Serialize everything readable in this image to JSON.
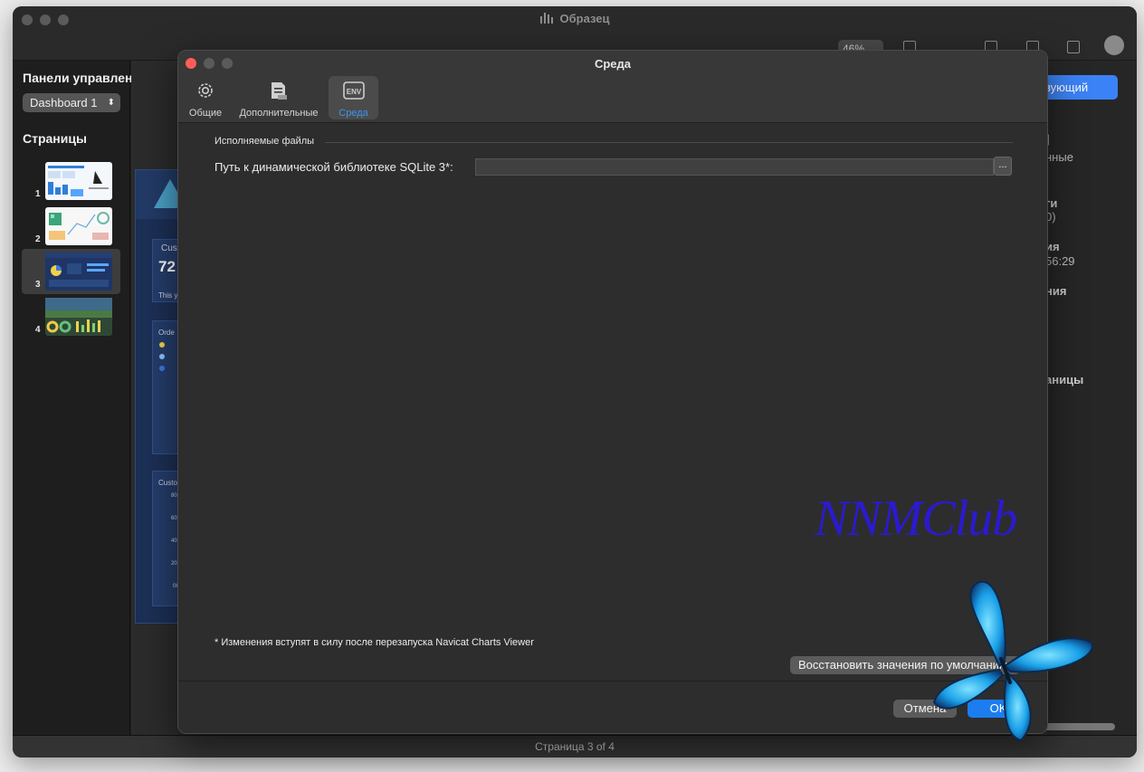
{
  "app": {
    "title": "Образец",
    "zoom": "46%",
    "status": "Страница 3 of 4"
  },
  "sidebar": {
    "title": "Панели управлени",
    "dashboard_select": "Dashboard 1",
    "pages_heading": "Страницы",
    "pages": [
      {
        "num": "1"
      },
      {
        "num": "2"
      },
      {
        "num": "3",
        "selected": true
      },
      {
        "num": "4"
      }
    ]
  },
  "background": {
    "card1_title": "Cus",
    "card1_value": "72",
    "card1_sub": "This y",
    "card2_title": "Orde",
    "card3_title": "Custo",
    "axis": [
      "80K",
      "60K",
      "40K",
      "20K",
      "0K"
    ],
    "right_button": "вующий",
    "right_texts": [
      "]",
      "нные",
      "ги",
      "0)",
      "ия",
      "56:29",
      "ния",
      "аницы"
    ]
  },
  "dialog": {
    "title": "Среда",
    "tabs": [
      {
        "label": "Общие",
        "icon": "gear-icon"
      },
      {
        "label": "Дополнительные",
        "icon": "document-icon"
      },
      {
        "label": "Среда",
        "icon": "env-icon",
        "selected": true
      }
    ],
    "section_title": "Исполняемые файлы",
    "field_label": "Путь к динамической библиотеке SQLite 3*:",
    "field_value": "",
    "browse_label": "...",
    "note": "* Изменения вступят в силу после перезапуска Navicat Charts Viewer",
    "restore_label": "Восстановить значения по умолчанию",
    "cancel_label": "Отмена",
    "ok_label": "OK"
  },
  "watermark": "NNMClub",
  "colors": {
    "accent": "#1b7df0",
    "selected_tab_text": "#3b95f0",
    "close_red": "#ff5f57",
    "watermark": "#2b1ad9"
  }
}
